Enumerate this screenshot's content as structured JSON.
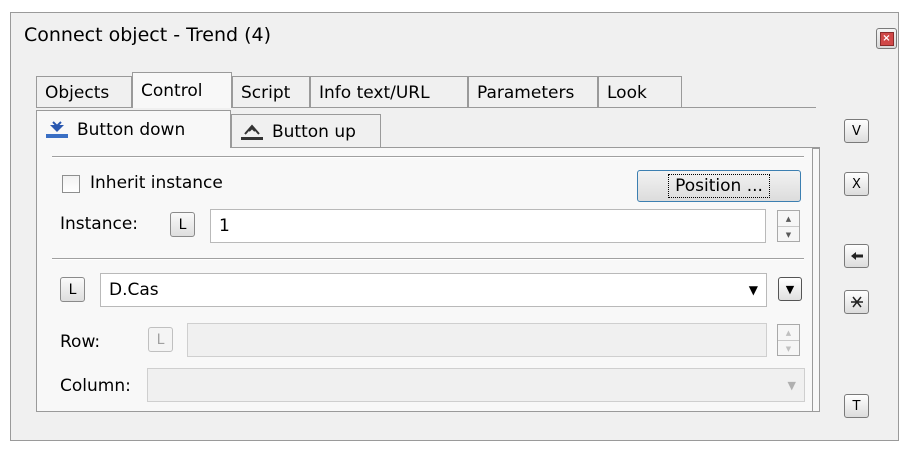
{
  "window": {
    "title": "Connect object - Trend (4)"
  },
  "tabs": [
    "Objects",
    "Control",
    "Script",
    "Info text/URL",
    "Parameters",
    "Look"
  ],
  "active_tab": "Control",
  "subtabs": {
    "button_down": "Button down",
    "button_up": "Button up"
  },
  "control": {
    "inherit_instance_label": "Inherit instance",
    "inherit_instance_checked": false,
    "position_button": "Position ...",
    "instance_label": "Instance:",
    "instance_l": "L",
    "instance_value": "1",
    "object_l": "L",
    "object_value": "D.Cas",
    "row_label": "Row:",
    "row_l": "L",
    "row_value": "",
    "column_label": "Column:",
    "column_value": ""
  },
  "side_buttons": {
    "v": "V",
    "x": "X",
    "t": "T"
  }
}
